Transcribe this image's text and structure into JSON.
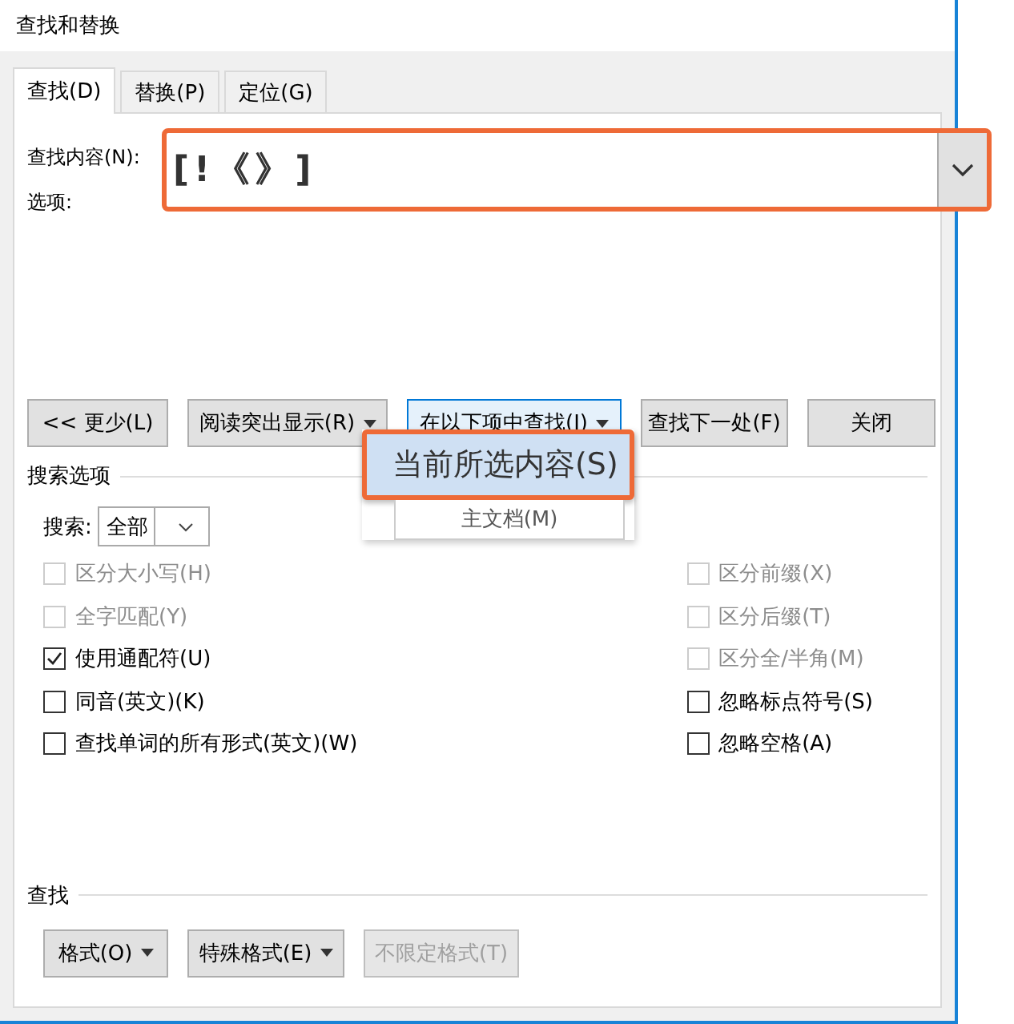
{
  "window": {
    "title": "查找和替换"
  },
  "tabs": [
    {
      "label": "查找(D)",
      "selected": true
    },
    {
      "label": "替换(P)",
      "selected": false
    },
    {
      "label": "定位(G)",
      "selected": false
    }
  ],
  "find": {
    "label": "查找内容(N):",
    "value": "[!《》]",
    "options_label": "选项:"
  },
  "buttons": [
    {
      "label": "<< 更少(L)",
      "dropdown": false,
      "active": false
    },
    {
      "label": "阅读突出显示(R)",
      "dropdown": true,
      "active": false
    },
    {
      "label": "在以下项中查找(I)",
      "dropdown": true,
      "active": true
    },
    {
      "label": "查找下一处(F)",
      "dropdown": false,
      "active": false
    },
    {
      "label": "关闭",
      "dropdown": false,
      "active": false
    }
  ],
  "menu": {
    "items": [
      {
        "label": "当前所选内容(S)",
        "selected": true
      },
      {
        "label": "主文档(M)",
        "selected": false
      }
    ]
  },
  "search_options": {
    "title": "搜索选项",
    "scope_label": "搜索:",
    "scope_value": "全部",
    "left": [
      {
        "label": "区分大小写(H)",
        "checked": false,
        "disabled": true
      },
      {
        "label": "全字匹配(Y)",
        "checked": false,
        "disabled": true
      },
      {
        "label": "使用通配符(U)",
        "checked": true,
        "disabled": false
      },
      {
        "label": "同音(英文)(K)",
        "checked": false,
        "disabled": false
      },
      {
        "label": "查找单词的所有形式(英文)(W)",
        "checked": false,
        "disabled": false
      }
    ],
    "right": [
      {
        "label": "区分前缀(X)",
        "checked": false,
        "disabled": true
      },
      {
        "label": "区分后缀(T)",
        "checked": false,
        "disabled": true
      },
      {
        "label": "区分全/半角(M)",
        "checked": false,
        "disabled": true
      },
      {
        "label": "忽略标点符号(S)",
        "checked": false,
        "disabled": false
      },
      {
        "label": "忽略空格(A)",
        "checked": false,
        "disabled": false
      }
    ]
  },
  "find_section": {
    "title": "查找",
    "buttons": [
      {
        "label": "格式(O)",
        "dropdown": true,
        "disabled": false
      },
      {
        "label": "特殊格式(E)",
        "dropdown": true,
        "disabled": false
      },
      {
        "label": "不限定格式(T)",
        "dropdown": false,
        "disabled": true
      }
    ]
  }
}
